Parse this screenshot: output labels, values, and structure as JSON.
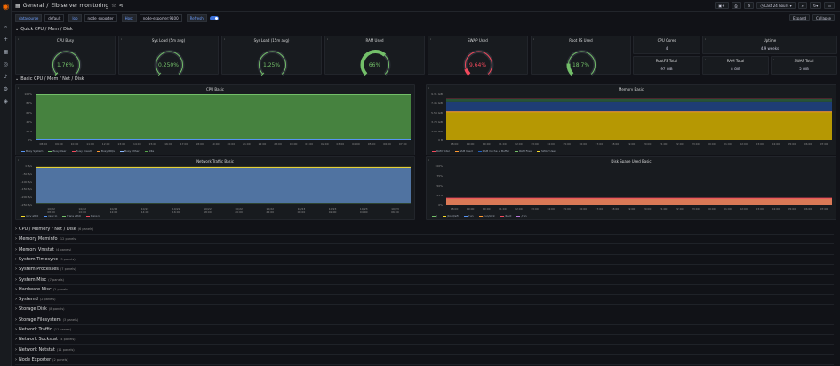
{
  "breadcrumb": {
    "folder": "General",
    "separator": "/",
    "title": "Elb server monitoring"
  },
  "time_picker": "Last 24 hours",
  "variables": [
    {
      "label": "datasource",
      "value": "default"
    },
    {
      "label": "Job",
      "value": "node_exporter"
    },
    {
      "label": "Host",
      "value": "node-exporter:9100"
    },
    {
      "label": "Refresh",
      "value": ""
    }
  ],
  "actions": {
    "expand": "Expand",
    "collapse": "Collapse"
  },
  "colors": {
    "green": "#73bf69",
    "red": "#f2495c",
    "bg": "#181b1f",
    "accent": "#3d71d9"
  },
  "rows": {
    "quick": "Quick CPU / Mem / Disk",
    "basic": "Basic CPU / Mem / Net / Disk"
  },
  "gauges": [
    {
      "title": "CPU Busy",
      "value": "1.76%",
      "pct": 0.0176,
      "color": "#73bf69"
    },
    {
      "title": "Sys Load (5m avg)",
      "value": "0.250%",
      "pct": 0.0025,
      "color": "#73bf69"
    },
    {
      "title": "Sys Load (15m avg)",
      "value": "1.25%",
      "pct": 0.0125,
      "color": "#73bf69"
    },
    {
      "title": "RAM Used",
      "value": "66%",
      "pct": 0.66,
      "color": "#73bf69"
    },
    {
      "title": "SWAP Used",
      "value": "9.64%",
      "pct": 0.0964,
      "color": "#f2495c"
    },
    {
      "title": "Root FS Used",
      "value": "18.7%",
      "pct": 0.187,
      "color": "#73bf69"
    }
  ],
  "stats": [
    {
      "title": "CPU Cores",
      "value": "4"
    },
    {
      "title": "Uptime",
      "value": "4.9 weeks"
    },
    {
      "title": "RootFS Total",
      "value": "97 GiB"
    },
    {
      "title": "RAM Total",
      "value": "8 GiB"
    },
    {
      "title": "SWAP Total",
      "value": "5 GiB"
    }
  ],
  "chart_data": [
    {
      "type": "area",
      "title": "CPU Basic",
      "x": [
        "08:00",
        "09:00",
        "10:00",
        "11:00",
        "12:00",
        "13:00",
        "14:00",
        "15:00",
        "16:00",
        "17:00",
        "18:00",
        "19:00",
        "20:00",
        "21:00",
        "22:00",
        "23:00",
        "00:00",
        "01:00",
        "02:00",
        "03:00",
        "04:00",
        "05:00",
        "06:00",
        "07:00"
      ],
      "yticks": [
        "100%",
        "80%",
        "60%",
        "40%",
        "20%",
        "0%"
      ],
      "series": [
        {
          "name": "Busy System",
          "color": "#5794f2"
        },
        {
          "name": "Busy User",
          "color": "#73bf69"
        },
        {
          "name": "Busy Iowait",
          "color": "#f2495c"
        },
        {
          "name": "Busy IRQs",
          "color": "#ff9830"
        },
        {
          "name": "Busy Other",
          "color": "#8ab8ff"
        },
        {
          "name": "Idle",
          "color": "#56a64b",
          "values": [
            100
          ]
        }
      ]
    },
    {
      "type": "area",
      "title": "Memory Basic",
      "x": [
        "08:00",
        "09:00",
        "10:00",
        "11:00",
        "12:00",
        "13:00",
        "14:00",
        "15:00",
        "16:00",
        "17:00",
        "18:00",
        "19:00",
        "20:00",
        "21:00",
        "22:00",
        "23:00",
        "00:00",
        "01:00",
        "02:00",
        "03:00",
        "04:00",
        "05:00",
        "06:00",
        "07:00"
      ],
      "yticks": [
        "9.31 GiB",
        "7.45 GiB",
        "5.59 GiB",
        "3.73 GiB",
        "1.86 GiB",
        "0 B"
      ],
      "series": [
        {
          "name": "RAM Total",
          "color": "#f2495c"
        },
        {
          "name": "RAM Used",
          "color": "#ff9830"
        },
        {
          "name": "RAM Cache + Buffer",
          "color": "#1f60c4"
        },
        {
          "name": "RAM Free",
          "color": "#73bf69"
        },
        {
          "name": "SWAP Used",
          "color": "#fade2a"
        }
      ]
    },
    {
      "type": "area",
      "title": "Network Traffic Basic",
      "x": [
        "10/22 08:00",
        "10/22 10:00",
        "10/22 12:00",
        "10/22 14:00",
        "10/22 16:00",
        "10/22 18:00",
        "10/22 20:00",
        "10/22 22:00",
        "10/23 00:00",
        "10/23 02:00",
        "10/23 04:00",
        "10/23 06:00"
      ],
      "yticks": [
        "0 B/s",
        "-50 B/s",
        "-100 B/s",
        "-150 B/s",
        "-200 B/s",
        "-250 B/s"
      ],
      "series": [
        {
          "name": "recv eth0",
          "color": "#fade2a"
        },
        {
          "name": "recv lo",
          "color": "#5794f2"
        },
        {
          "name": "trans eth0",
          "color": "#73bf69"
        },
        {
          "name": "trans lo",
          "color": "#f2495c"
        }
      ]
    },
    {
      "type": "area",
      "title": "Disk Space Used Basic",
      "x": [
        "08:00",
        "09:00",
        "10:00",
        "11:00",
        "12:00",
        "13:00",
        "14:00",
        "15:00",
        "16:00",
        "17:00",
        "18:00",
        "19:00",
        "20:00",
        "21:00",
        "22:00",
        "23:00",
        "00:00",
        "01:00",
        "02:00",
        "03:00",
        "04:00",
        "05:00",
        "06:00",
        "07:00"
      ],
      "yticks": [
        "100%",
        "75%",
        "50%",
        "25%",
        "0%"
      ],
      "series": [
        {
          "name": "/",
          "color": "#73bf69"
        },
        {
          "name": "/boot/efi",
          "color": "#fade2a"
        },
        {
          "name": "/run",
          "color": "#5794f2"
        },
        {
          "name": "/run/lock",
          "color": "#ff9830"
        },
        {
          "name": "/boot",
          "color": "#f2495c"
        },
        {
          "name": "/run",
          "color": "#b877d9"
        }
      ]
    }
  ],
  "collapsed_rows": [
    {
      "title": "CPU / Memory / Net / Disk",
      "count": "(6 panels)"
    },
    {
      "title": "Memory Meminfo",
      "count": "(12 panels)"
    },
    {
      "title": "Memory Vmstat",
      "count": "(4 panels)"
    },
    {
      "title": "System Timesync",
      "count": "(3 panels)"
    },
    {
      "title": "System Processes",
      "count": "(7 panels)"
    },
    {
      "title": "System Misc",
      "count": "(7 panels)"
    },
    {
      "title": "Hardware Misc",
      "count": "(2 panels)"
    },
    {
      "title": "Systemd",
      "count": "(2 panels)"
    },
    {
      "title": "Storage Disk",
      "count": "(8 panels)"
    },
    {
      "title": "Storage Filesystem",
      "count": "(3 panels)"
    },
    {
      "title": "Network Traffic",
      "count": "(11 panels)"
    },
    {
      "title": "Network Sockstat",
      "count": "(4 panels)"
    },
    {
      "title": "Network Netstat",
      "count": "(11 panels)"
    },
    {
      "title": "Node Exporter",
      "count": "(2 panels)"
    }
  ]
}
